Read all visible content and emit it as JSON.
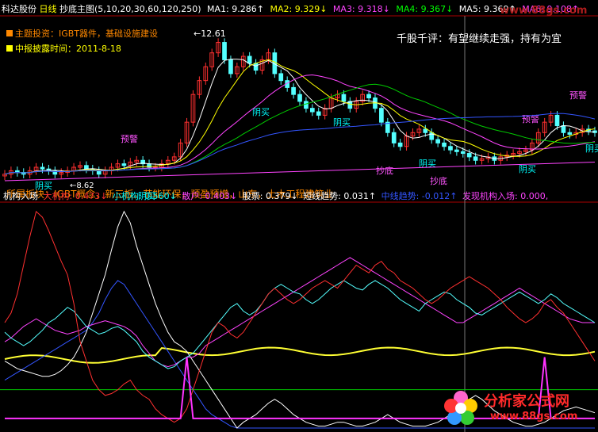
{
  "header": {
    "stock_name": "科达股份",
    "period": "日线",
    "indicator": "抄底主图",
    "params": "(5,10,20,30,60,120,250)",
    "ma_items": [
      {
        "label": "MA1: 9.286↑",
        "color": "#ffffff"
      },
      {
        "label": "MA2: 9.329↓",
        "color": "#ffff00"
      },
      {
        "label": "MA3: 9.318↓",
        "color": "#ff44ff"
      },
      {
        "label": "MA4: 9.367↓",
        "color": "#00ff00"
      },
      {
        "label": "MA5: 9.369↑",
        "color": "#ffffff"
      },
      {
        "label": "MA6: 9.108↑",
        "color": "#ff44ff"
      }
    ]
  },
  "watermark": "www.88gs.com",
  "topic": {
    "label": "主题投资：IGBT器件，基础设施建设",
    "color": "#ff8800"
  },
  "report_date": {
    "label": "中报披露时间：2011-8-18",
    "color": "#ffff00"
  },
  "high_label": "←12.61",
  "low_label": "←8.62",
  "comment": "千股千评：有望继续走强，持有为宜",
  "concepts": "所属板块：IGBT概念，新三板，节能环保，预盈预增，山东，土木工程建筑业",
  "annotations": [
    {
      "text": "预警",
      "color": "#ff55ff"
    },
    {
      "text": "预警",
      "color": "#ff55ff"
    },
    {
      "text": "预警",
      "color": "#ff55ff"
    },
    {
      "text": "阴买",
      "color": "#00ffff"
    },
    {
      "text": "阴买",
      "color": "#00ffff"
    },
    {
      "text": "阴买",
      "color": "#00ffff"
    },
    {
      "text": "阴买",
      "color": "#00ffff"
    },
    {
      "text": "阴买",
      "color": "#00ffff"
    },
    {
      "text": "阴买",
      "color": "#00ffff"
    },
    {
      "text": "抄底",
      "color": "#ff55ff"
    },
    {
      "text": "抄底",
      "color": "#ff55ff"
    },
    {
      "text": "阴买",
      "color": "#00ffff"
    }
  ],
  "sub_header": {
    "title": "机构入场",
    "items": [
      {
        "label": "大机构: 0.473↓",
        "color": "#ff3030"
      },
      {
        "label": "小机构: 0.560↓",
        "color": "#00ffff"
      },
      {
        "label": "散户: 0.403↓",
        "color": "#ff44ff"
      },
      {
        "label": "股票: 0.379↓",
        "color": "#ffffff"
      },
      {
        "label": "短线趋势: 0.031↑",
        "color": "#ffffff"
      },
      {
        "label": "中线趋势: -0.012↑",
        "color": "#3355ff"
      },
      {
        "label": "发现机构入场: 0.000,",
        "color": "#ff44ff"
      }
    ]
  },
  "logo": {
    "text": "分析家公式网",
    "url": "www.88gs.com"
  },
  "chart_data": [
    {
      "type": "candlestick",
      "title": "抄底主图",
      "series": [
        {
          "name": "MA1",
          "last": 9.286
        },
        {
          "name": "MA2",
          "last": 9.329
        },
        {
          "name": "MA3",
          "last": 9.318
        },
        {
          "name": "MA4",
          "last": 9.367
        },
        {
          "name": "MA5",
          "last": 9.369
        },
        {
          "name": "MA6",
          "last": 9.108
        }
      ],
      "high": 12.61,
      "low": 8.62,
      "close_values": [
        8.7,
        8.8,
        8.75,
        8.7,
        8.8,
        8.9,
        8.85,
        8.8,
        8.7,
        8.75,
        8.8,
        8.9,
        8.95,
        8.85,
        8.8,
        8.7,
        8.8,
        8.9,
        9.0,
        8.95,
        9.05,
        9.1,
        9.0,
        8.9,
        8.9,
        9.0,
        9.1,
        9.2,
        9.6,
        10.2,
        11.0,
        11.4,
        11.8,
        12.2,
        12.5,
        12.0,
        11.6,
        11.8,
        12.1,
        11.9,
        11.7,
        12.0,
        12.2,
        11.6,
        11.4,
        11.2,
        11.0,
        10.8,
        10.6,
        10.5,
        10.4,
        10.6,
        10.9,
        11.0,
        10.8,
        10.6,
        10.8,
        11.0,
        10.9,
        10.6,
        10.2,
        9.9,
        9.6,
        9.5,
        9.8,
        9.9,
        10.0,
        9.9,
        9.7,
        9.6,
        9.5,
        9.4,
        9.35,
        9.3,
        9.2,
        9.1,
        9.15,
        9.2,
        9.1,
        9.2,
        9.25,
        9.3,
        9.35,
        9.4,
        9.6,
        9.9,
        10.2,
        10.4,
        10.1,
        9.9,
        9.85,
        9.9,
        10.0,
        9.95,
        9.9
      ]
    },
    {
      "type": "line",
      "title": "机构入场",
      "series": [
        {
          "name": "大机构",
          "last": 0.473
        },
        {
          "name": "小机构",
          "last": 0.56
        },
        {
          "name": "散户",
          "last": 0.403
        },
        {
          "name": "股票",
          "last": 0.379
        },
        {
          "name": "短线趋势",
          "last": 0.031
        },
        {
          "name": "中线趋势",
          "last": -0.012
        },
        {
          "name": "发现机构入场",
          "last": 0.0
        }
      ],
      "x_count": 95,
      "ylim": [
        -0.15,
        1.0
      ],
      "lines": {
        "big": [
          0.4,
          0.45,
          0.55,
          0.7,
          0.85,
          0.98,
          0.95,
          0.88,
          0.8,
          0.72,
          0.65,
          0.5,
          0.3,
          0.2,
          0.1,
          0.05,
          0.02,
          0.03,
          0.05,
          0.08,
          0.1,
          0.05,
          0.02,
          0.0,
          -0.05,
          -0.08,
          -0.1,
          -0.12,
          -0.1,
          -0.05,
          0.05,
          0.15,
          0.25,
          0.35,
          0.4,
          0.38,
          0.34,
          0.32,
          0.35,
          0.4,
          0.45,
          0.5,
          0.55,
          0.58,
          0.55,
          0.52,
          0.5,
          0.52,
          0.55,
          0.58,
          0.6,
          0.62,
          0.6,
          0.58,
          0.62,
          0.66,
          0.7,
          0.68,
          0.66,
          0.7,
          0.72,
          0.68,
          0.66,
          0.62,
          0.6,
          0.58,
          0.55,
          0.52,
          0.5,
          0.52,
          0.55,
          0.58,
          0.6,
          0.62,
          0.64,
          0.62,
          0.6,
          0.58,
          0.55,
          0.52,
          0.48,
          0.45,
          0.42,
          0.4,
          0.42,
          0.45,
          0.5,
          0.52,
          0.48,
          0.45,
          0.4,
          0.35,
          0.3,
          0.25,
          0.2
        ],
        "small": [
          0.35,
          0.32,
          0.3,
          0.28,
          0.3,
          0.33,
          0.36,
          0.4,
          0.42,
          0.45,
          0.48,
          0.46,
          0.42,
          0.38,
          0.36,
          0.34,
          0.35,
          0.37,
          0.38,
          0.36,
          0.33,
          0.3,
          0.25,
          0.22,
          0.2,
          0.18,
          0.16,
          0.17,
          0.2,
          0.22,
          0.24,
          0.28,
          0.32,
          0.36,
          0.4,
          0.44,
          0.48,
          0.5,
          0.46,
          0.44,
          0.46,
          0.5,
          0.55,
          0.58,
          0.6,
          0.58,
          0.56,
          0.55,
          0.52,
          0.5,
          0.52,
          0.55,
          0.58,
          0.6,
          0.62,
          0.6,
          0.58,
          0.57,
          0.6,
          0.62,
          0.6,
          0.58,
          0.55,
          0.52,
          0.5,
          0.48,
          0.46,
          0.5,
          0.52,
          0.54,
          0.56,
          0.55,
          0.52,
          0.5,
          0.48,
          0.45,
          0.44,
          0.46,
          0.48,
          0.5,
          0.52,
          0.54,
          0.56,
          0.54,
          0.52,
          0.5,
          0.52,
          0.55,
          0.53,
          0.5,
          0.48,
          0.46,
          0.44,
          0.42,
          0.4
        ],
        "retail": [
          0.3,
          0.32,
          0.35,
          0.38,
          0.4,
          0.42,
          0.4,
          0.38,
          0.36,
          0.35,
          0.34,
          0.35,
          0.36,
          0.38,
          0.39,
          0.4,
          0.41,
          0.4,
          0.39,
          0.38,
          0.36,
          0.33,
          0.28,
          0.24,
          0.2,
          0.18,
          0.17,
          0.18,
          0.2,
          0.22,
          0.22,
          0.24,
          0.28,
          0.3,
          0.32,
          0.34,
          0.36,
          0.38,
          0.4,
          0.42,
          0.44,
          0.46,
          0.48,
          0.5,
          0.52,
          0.54,
          0.56,
          0.58,
          0.6,
          0.62,
          0.64,
          0.66,
          0.68,
          0.7,
          0.72,
          0.74,
          0.72,
          0.7,
          0.68,
          0.66,
          0.64,
          0.62,
          0.6,
          0.58,
          0.56,
          0.54,
          0.52,
          0.5,
          0.48,
          0.46,
          0.44,
          0.42,
          0.4,
          0.4,
          0.42,
          0.44,
          0.46,
          0.48,
          0.5,
          0.52,
          0.54,
          0.56,
          0.58,
          0.56,
          0.54,
          0.52,
          0.5,
          0.48,
          0.46,
          0.44,
          0.42,
          0.41,
          0.4,
          0.4,
          0.4
        ],
        "stock": [
          0.2,
          0.18,
          0.16,
          0.15,
          0.14,
          0.13,
          0.12,
          0.12,
          0.13,
          0.15,
          0.18,
          0.22,
          0.28,
          0.35,
          0.45,
          0.55,
          0.65,
          0.78,
          0.9,
          0.98,
          0.92,
          0.8,
          0.7,
          0.6,
          0.5,
          0.42,
          0.35,
          0.3,
          0.28,
          0.25,
          0.2,
          0.15,
          0.1,
          0.05,
          0.0,
          -0.05,
          -0.1,
          -0.15,
          -0.12,
          -0.1,
          -0.08,
          -0.05,
          -0.02,
          0.0,
          -0.02,
          -0.05,
          -0.08,
          -0.1,
          -0.12,
          -0.13,
          -0.14,
          -0.14,
          -0.13,
          -0.12,
          -0.12,
          -0.13,
          -0.14,
          -0.14,
          -0.13,
          -0.12,
          -0.1,
          -0.08,
          -0.1,
          -0.12,
          -0.13,
          -0.14,
          -0.14,
          -0.14,
          -0.13,
          -0.12,
          -0.1,
          -0.08,
          -0.05,
          -0.02,
          0.0,
          0.02,
          0.0,
          -0.03,
          -0.06,
          -0.08,
          -0.1,
          -0.12,
          -0.13,
          -0.14,
          -0.14,
          -0.13,
          -0.12,
          -0.1,
          -0.08,
          -0.06,
          -0.05,
          -0.04,
          -0.05,
          -0.06,
          -0.07
        ],
        "mid_trend": [
          0.1,
          0.12,
          0.14,
          0.16,
          0.18,
          0.2,
          0.22,
          0.24,
          0.26,
          0.28,
          0.3,
          0.32,
          0.34,
          0.36,
          0.4,
          0.45,
          0.52,
          0.58,
          0.62,
          0.6,
          0.55,
          0.5,
          0.45,
          0.4,
          0.35,
          0.3,
          0.25,
          0.2,
          0.15,
          0.1,
          0.05,
          0.0,
          -0.05,
          -0.08,
          -0.1,
          -0.12,
          -0.14,
          -0.15,
          -0.15,
          -0.15,
          -0.15,
          -0.15,
          -0.15,
          -0.15,
          -0.15,
          -0.15,
          -0.15,
          -0.15,
          -0.15,
          -0.15,
          -0.15,
          -0.15,
          -0.15,
          -0.15,
          -0.15,
          -0.15,
          -0.15,
          -0.15,
          -0.15,
          -0.15,
          -0.15,
          -0.15,
          -0.15,
          -0.15,
          -0.15,
          -0.15,
          -0.15,
          -0.15,
          -0.15,
          -0.15,
          -0.15,
          -0.15,
          -0.15,
          -0.15,
          -0.15,
          -0.15,
          -0.15,
          -0.15,
          -0.15,
          -0.15,
          -0.15,
          -0.15,
          -0.15,
          -0.15,
          -0.15,
          -0.15,
          -0.15,
          -0.15,
          -0.15,
          -0.15,
          -0.15,
          -0.15,
          -0.15,
          -0.15,
          -0.15
        ],
        "yellow_level": 0.25,
        "green_level": 0.05
      }
    }
  ]
}
